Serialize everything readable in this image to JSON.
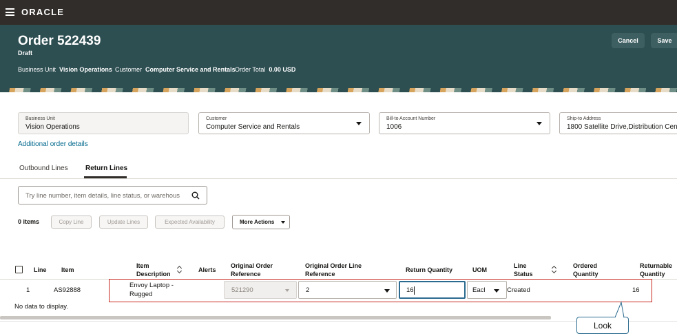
{
  "app": {
    "logo": "ORACLE"
  },
  "order": {
    "title": "Order 522439",
    "status": "Draft",
    "business_unit_label": "Business Unit",
    "business_unit_value": "Vision Operations",
    "customer_label": "Customer",
    "customer_value": "Computer Service and Rentals",
    "order_total_label": "Order Total",
    "order_total_value": "0.00 USD"
  },
  "actions": {
    "cancel": "Cancel",
    "save": "Save"
  },
  "form": {
    "business_unit": {
      "label": "Business Unit",
      "value": "Vision Operations"
    },
    "customer": {
      "label": "Customer",
      "value": "Computer Service and Rentals"
    },
    "bill_to": {
      "label": "Bill-to Account Number",
      "value": "1006"
    },
    "ship_to": {
      "label": "Ship-to Address",
      "value": "1800 Satellite Drive,Distribution Cen"
    },
    "additional_details": "Additional order details"
  },
  "tabs": [
    {
      "label": "Outbound Lines",
      "active": false
    },
    {
      "label": "Return Lines",
      "active": true
    }
  ],
  "toolbar": {
    "search_placeholder": "Try line number, item details, line status, or warehous",
    "items_count": "0 items",
    "copy_line": "Copy Line",
    "update_lines": "Update Lines",
    "expected_availability": "Expected Availability",
    "more_actions": "More Actions"
  },
  "table": {
    "headers": {
      "line": "Line",
      "item": "Item",
      "item_description_1": "Item",
      "item_description_2": "Description",
      "alerts": "Alerts",
      "orig_order_ref_1": "Original Order",
      "orig_order_ref_2": "Reference",
      "orig_line_ref_1": "Original Order Line",
      "orig_line_ref_2": "Reference",
      "return_qty": "Return Quantity",
      "uom": "UOM",
      "line_status_1": "Line",
      "line_status_2": "Status",
      "ordered_qty_1": "Ordered",
      "ordered_qty_2": "Quantity",
      "returnable_qty_1": "Returnable",
      "returnable_qty_2": "Quantity"
    },
    "row": {
      "line": "1",
      "item": "AS92888",
      "description_1": "Envoy Laptop -",
      "description_2": "Rugged",
      "orig_order_ref": "521290",
      "orig_line_ref": "2",
      "return_qty": "16",
      "uom": "Eacl",
      "line_status": "Created",
      "returnable_qty": "16"
    },
    "no_data": "No data to display."
  },
  "callout": {
    "text": "Look"
  },
  "colors": {
    "topbar": "#312d2a",
    "header": "#2e4f52",
    "link": "#00688c",
    "highlight_box": "#c8261e",
    "focus": "#2c6b8f"
  }
}
